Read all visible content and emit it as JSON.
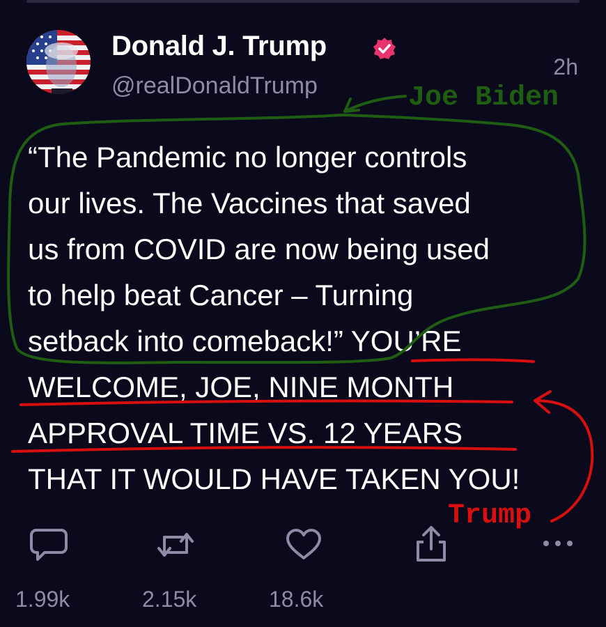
{
  "header": {
    "display_name": "Donald J. Trump",
    "handle": "@realDonaldTrump",
    "timestamp": "2h",
    "verified_badge": "verified-badge-icon"
  },
  "post": {
    "lines": [
      "“The Pandemic no longer controls",
      "our lives. The Vaccines that saved",
      "us from COVID are now being used",
      "to help beat Cancer – Turning",
      "setback into comeback!” YOU’RE",
      "WELCOME, JOE, NINE MONTH",
      "APPROVAL TIME VS. 12 YEARS",
      "THAT IT WOULD HAVE TAKEN YOU!"
    ]
  },
  "annotations": {
    "green_label": "Joe Biden",
    "red_label": "Trump",
    "green_color": "#1f5e12",
    "red_color": "#d70f0f"
  },
  "actions": {
    "reply_count": "1.99k",
    "repost_count": "2.15k",
    "like_count": "18.6k",
    "icons": [
      "reply-icon",
      "repost-icon",
      "like-icon",
      "share-icon",
      "more-icon"
    ]
  },
  "colors": {
    "background": "#0b0a1c",
    "muted_text": "#8e8ba6",
    "verified_pink": "#e8336d"
  }
}
